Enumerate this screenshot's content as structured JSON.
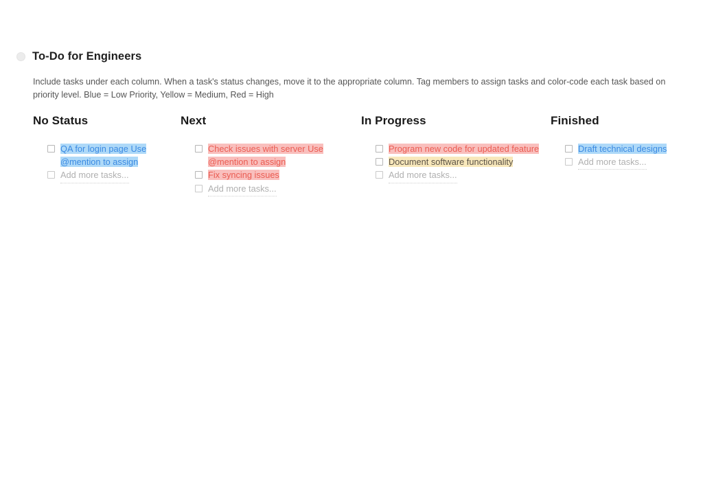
{
  "document": {
    "title": "To-Do for Engineers",
    "collapse_toggle_icon": "circle-toggle-icon",
    "description": "Include tasks under each column. When a task's status changes, move it to the appropriate column. Tag members to assign tasks and color-code each task based on priority level. Blue = Low Priority, Yellow = Medium,  Red = High"
  },
  "legend": {
    "blue_label": "Blue = Low Priority",
    "yellow_label": "Yellow = Medium",
    "red_label": "Red = High"
  },
  "colors": {
    "blue_highlight": "#aed9f8",
    "blue_text": "#3b8ae2",
    "red_highlight": "#f9bfbd",
    "red_text": "#ea5c52",
    "yellow_highlight": "#f8e8bb",
    "yellow_text": "#5b5246",
    "placeholder_text": "#b0b0b0",
    "page_background": "#ffffff"
  },
  "board": {
    "add_task_placeholder": "Add more tasks...",
    "columns": [
      {
        "title": "No Status",
        "tasks": [
          {
            "text": "QA for login page Use @mention to assign",
            "priority": "blue",
            "checked": false
          }
        ],
        "placeholder": "Add more tasks..."
      },
      {
        "title": "Next",
        "tasks": [
          {
            "text": "Check issues with server Use @mention to assign",
            "priority": "red",
            "checked": false
          },
          {
            "text": "Fix syncing issues",
            "priority": "red",
            "checked": false
          }
        ],
        "placeholder": "Add more tasks..."
      },
      {
        "title": "In Progress",
        "tasks": [
          {
            "text": "Program new code for updated feature",
            "priority": "red",
            "checked": false
          },
          {
            "text": "Document software functionality",
            "priority": "yellow",
            "checked": false
          }
        ],
        "placeholder": "Add more tasks..."
      },
      {
        "title": "Finished",
        "tasks": [
          {
            "text": "Draft technical designs",
            "priority": "blue",
            "checked": false
          }
        ],
        "placeholder": "Add more tasks..."
      }
    ]
  }
}
